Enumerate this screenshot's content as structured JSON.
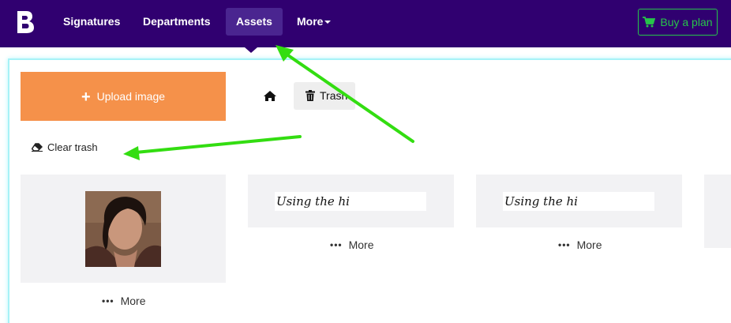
{
  "topbar": {
    "logo_alt": "B",
    "nav": [
      {
        "label": "Signatures"
      },
      {
        "label": "Departments"
      },
      {
        "label": "Assets"
      },
      {
        "label": "More"
      }
    ],
    "buy_label": "Buy a plan"
  },
  "toolbar": {
    "upload_label": "Upload image",
    "breadcrumb_trash": "Trash",
    "clear_trash_label": "Clear trash"
  },
  "assets": [
    {
      "type": "image",
      "more_label": "More"
    },
    {
      "type": "signature",
      "preview_text": "Using the hi",
      "more_label": "More"
    },
    {
      "type": "signature",
      "preview_text": "Using the hi",
      "more_label": "More"
    }
  ],
  "colors": {
    "topbar": "#300070",
    "accent_orange": "#f5914a",
    "buy_green": "#27c44a",
    "annotation_arrow": "#33dd11"
  }
}
